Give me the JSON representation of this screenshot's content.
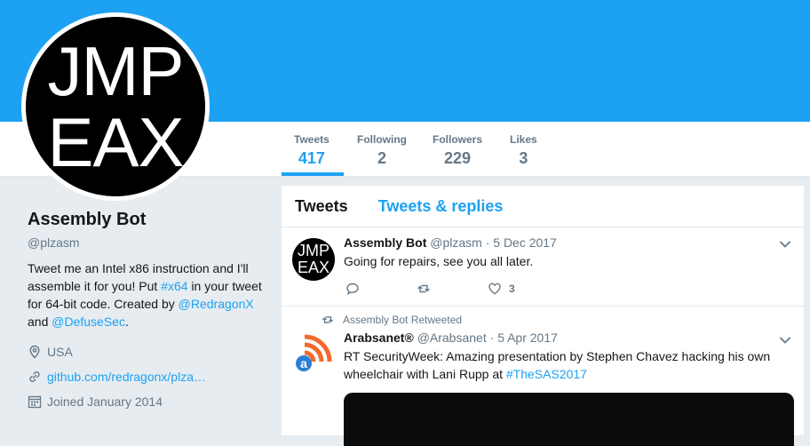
{
  "avatar": {
    "line1": "JMP",
    "line2": "EAX"
  },
  "stats": [
    {
      "label": "Tweets",
      "value": "417"
    },
    {
      "label": "Following",
      "value": "2"
    },
    {
      "label": "Followers",
      "value": "229"
    },
    {
      "label": "Likes",
      "value": "3"
    }
  ],
  "profile": {
    "name": "Assembly Bot",
    "handle": "@plzasm",
    "bio_1": "Tweet me an Intel x86 instruction and I'll assemble it for you! Put ",
    "bio_hashtag": "#x64",
    "bio_2": " in your tweet for 64-bit code. Created by ",
    "bio_mention1": "@RedragonX",
    "bio_3": " and ",
    "bio_mention2": "@DefuseSec",
    "bio_4": ".",
    "location": "USA",
    "website": "github.com/redragonx/plza…",
    "joined": "Joined January 2014"
  },
  "timeline": {
    "tabs": [
      "Tweets",
      "Tweets & replies"
    ],
    "tweets": [
      {
        "author": "Assembly Bot",
        "handle": "@plzasm",
        "sep": "·",
        "date": "5 Dec 2017",
        "text": "Going for repairs, see you all later.",
        "likes": "3"
      },
      {
        "retweet_context": "Assembly Bot Retweeted",
        "author": "Arabsanet®",
        "handle": "@Arabsanet",
        "sep": "·",
        "date": "5 Apr 2017",
        "text_1": "RT SecurityWeek: Amazing presentation by Stephen Chavez hacking his own wheelchair with Lani Rupp at ",
        "hashtag": "#TheSAS2017",
        "logo_letter": "a"
      }
    ]
  },
  "colors": {
    "accent": "#1da1f2",
    "gray": "#657786",
    "text": "#14171a",
    "background": "#e6ecf0"
  }
}
